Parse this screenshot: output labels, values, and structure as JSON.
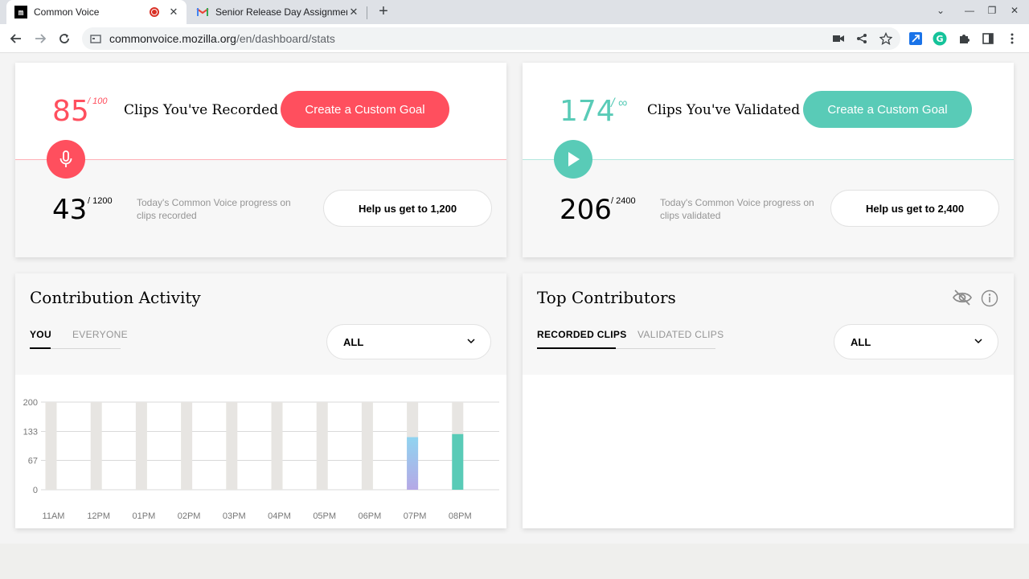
{
  "browser": {
    "tabs": [
      {
        "title": "Common Voice"
      },
      {
        "title": "Senior Release Day Assignment"
      }
    ],
    "url_host": "commonvoice.mozilla.org",
    "url_path": "/en/dashboard/stats"
  },
  "recorded_goal": {
    "value": "85",
    "target": "/ 100",
    "label": "Clips You've Recorded",
    "button": "Create a Custom Goal",
    "today_value": "43",
    "today_target": "/ 1200",
    "today_text": "Today's Common Voice progress on clips recorded",
    "help_button": "Help us get to 1,200"
  },
  "validated_goal": {
    "value": "174",
    "target": "/ ∞",
    "label": "Clips You've Validated",
    "button": "Create a Custom Goal",
    "today_value": "206",
    "today_target": "/ 2400",
    "today_text": "Today's Common Voice progress on clips validated",
    "help_button": "Help us get to 2,400"
  },
  "activity": {
    "title": "Contribution Activity",
    "tabs": [
      "YOU",
      "EVERYONE"
    ],
    "dropdown": "ALL"
  },
  "contributors": {
    "title": "Top Contributors",
    "tabs": [
      "RECORDED CLIPS",
      "VALIDATED CLIPS"
    ],
    "dropdown": "ALL"
  },
  "colors": {
    "record": "#ff4f5e",
    "validate": "#59cbb7",
    "bar_bg": "#e7e5e2"
  },
  "chart_data": {
    "type": "bar",
    "categories": [
      "11AM",
      "12PM",
      "01PM",
      "02PM",
      "03PM",
      "04PM",
      "05PM",
      "06PM",
      "07PM",
      "08PM"
    ],
    "series": [
      {
        "values": [
          0,
          0,
          0,
          0,
          0,
          0,
          0,
          0,
          120,
          0
        ]
      },
      {
        "values": [
          0,
          0,
          0,
          0,
          0,
          0,
          0,
          0,
          0,
          127
        ]
      }
    ],
    "background_max": 200,
    "yticks": [
      "200",
      "133",
      "67",
      "0"
    ],
    "ylim": [
      0,
      200
    ],
    "grid": true
  }
}
